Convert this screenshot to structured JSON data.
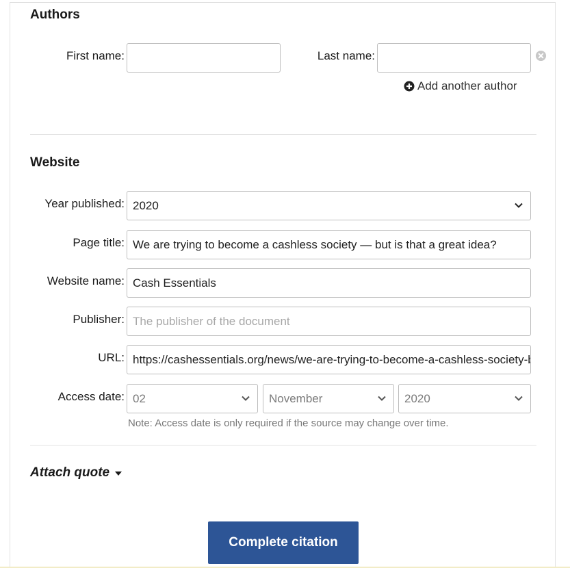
{
  "authors": {
    "heading": "Authors",
    "first_name_label": "First name:",
    "first_name_value": "",
    "last_name_label": "Last name:",
    "last_name_value": "",
    "add_author_label": "Add another author",
    "remove_icon": "close-circle-icon",
    "add_icon": "plus-circle-icon"
  },
  "website": {
    "heading": "Website",
    "year_label": "Year published:",
    "year_value": "2020",
    "page_title_label": "Page title:",
    "page_title_value": "We are trying to become a cashless society — but is that a great idea?",
    "website_name_label": "Website name:",
    "website_name_value": "Cash Essentials",
    "publisher_label": "Publisher:",
    "publisher_placeholder": "The publisher of the document",
    "url_label": "URL:",
    "url_value": "https://cashessentials.org/news/we-are-trying-to-become-a-cashless-society-but-is-that-a-great-idea",
    "access_date_label": "Access date:",
    "access_day": "02",
    "access_month": "November",
    "access_year": "2020",
    "note": "Note: Access date is only required if the source may change over time."
  },
  "attach_quote_label": "Attach quote",
  "complete_button_label": "Complete citation",
  "colors": {
    "button": "#2d5596",
    "border": "#bdbdbd",
    "note_text": "#777777"
  }
}
